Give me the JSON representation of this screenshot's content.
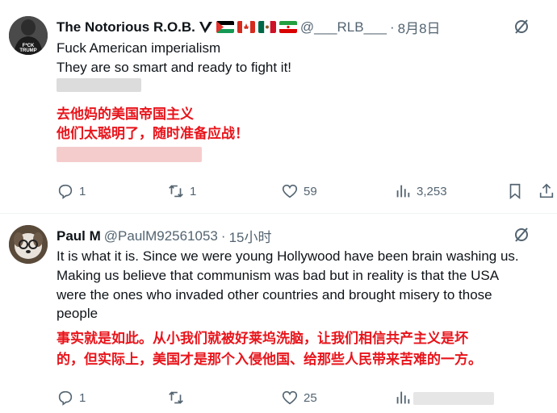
{
  "tweets": [
    {
      "name": "The Notorious R.O.B.",
      "handle": "@___RLB___",
      "dot": "·",
      "time": "8月8日",
      "text_lines": [
        "Fuck American imperialism",
        "They are so smart and ready to fight it!"
      ],
      "translation_lines": [
        "去他妈的美国帝国主义",
        "他们太聪明了，随时准备应战！"
      ],
      "avatar_text": "F*CK TRUMP",
      "replies": "1",
      "reposts": "1",
      "likes": "59",
      "views": "3,253"
    },
    {
      "name": "Paul M",
      "handle": "@PaulM92561053",
      "dot": "·",
      "time": "15小时",
      "text_lines": [
        "It is what it is.  Since we were young Hollywood have been brain washing us.",
        "Making us believe that communism was bad but in reality is that the USA",
        "were the ones who invaded other countries and brought misery to those",
        "people"
      ],
      "translation_lines": [
        "事实就是如此。从小我们就被好莱坞洗脑，让我们相信共产主义是坏",
        "的，但实际上，美国才是那个入侵他国、给那些人民带来苦难的一方。"
      ],
      "replies": "1",
      "reposts": "",
      "likes": "25",
      "views": ""
    }
  ],
  "colors": {
    "text": "#0f1419",
    "secondary": "#536471",
    "translation_red": "#e8141b",
    "verified_blue": "#1d9bf0"
  },
  "icons": [
    "verified-badge-icon",
    "flag-palestine-icon",
    "flag-canada-icon",
    "flag-mexico-icon",
    "flag-iran-icon",
    "grok-icon",
    "reply-icon",
    "repost-icon",
    "like-icon",
    "views-icon",
    "bookmark-icon",
    "share-icon"
  ]
}
